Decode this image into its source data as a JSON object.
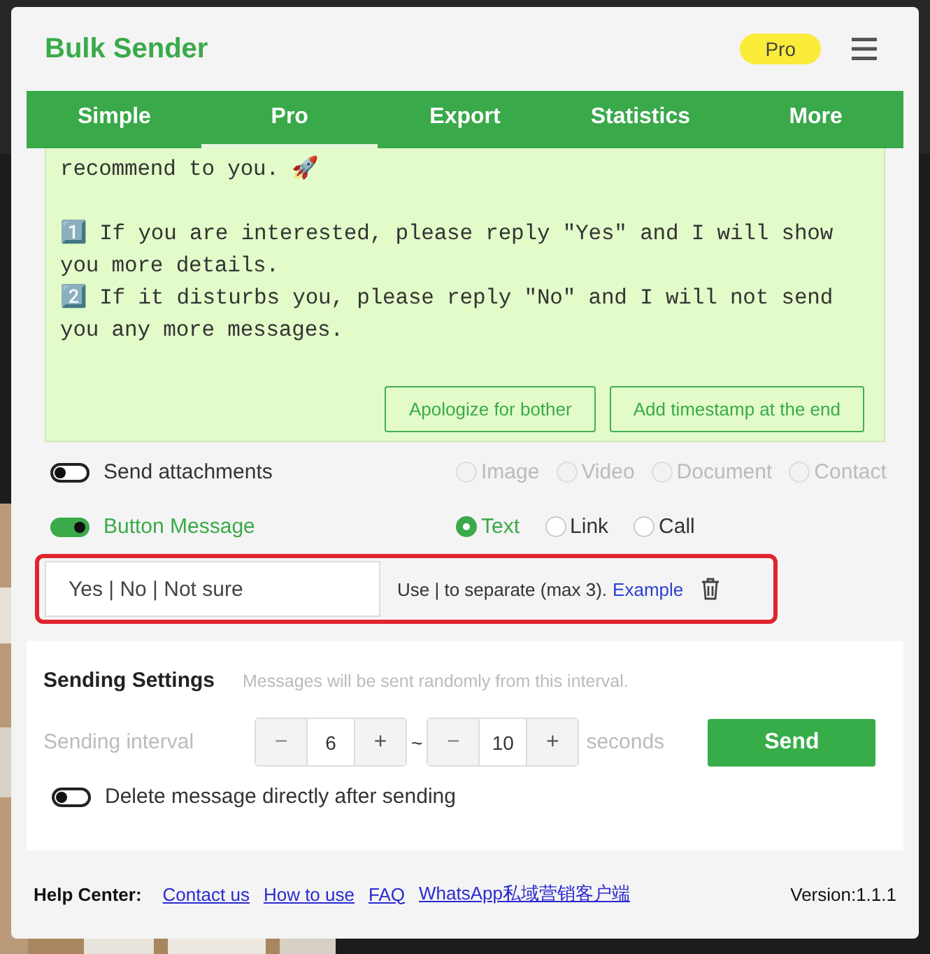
{
  "app": {
    "title": "Bulk Sender",
    "badge": "Pro"
  },
  "tabs": [
    {
      "label": "Simple",
      "selected": false
    },
    {
      "label": "Pro",
      "selected": true
    },
    {
      "label": "Export",
      "selected": false
    },
    {
      "label": "Statistics",
      "selected": false
    },
    {
      "label": "More",
      "selected": false
    }
  ],
  "message": {
    "text": "recommend to you. 🚀\n\n1️⃣ If you are interested, please reply \"Yes\" and I will show you more details.\n2️⃣ If it disturbs you, please reply \"No\" and I will not send you any more messages.",
    "buttons": [
      "Apologize for bother",
      "Add timestamp at the end"
    ]
  },
  "attachments": {
    "label": "Send attachments",
    "on": false,
    "types": [
      {
        "label": "Image",
        "selected": false,
        "disabled": true
      },
      {
        "label": "Video",
        "selected": false,
        "disabled": true
      },
      {
        "label": "Document",
        "selected": false,
        "disabled": true
      },
      {
        "label": "Contact",
        "selected": false,
        "disabled": true
      }
    ]
  },
  "button_message": {
    "label": "Button Message",
    "on": true,
    "types": [
      {
        "label": "Text",
        "selected": true
      },
      {
        "label": "Link",
        "selected": false
      },
      {
        "label": "Call",
        "selected": false
      }
    ],
    "value": "Yes | No | Not sure",
    "hint": "Use | to separate (max 3).",
    "link": "Example"
  },
  "sending_settings": {
    "title": "Sending Settings",
    "note": "Messages will be sent randomly from this interval.",
    "interval_label": "Sending interval",
    "steppers": [
      {
        "minus": "−",
        "value": "6",
        "plus": "+"
      },
      {
        "minus": "−",
        "value": "10",
        "plus": "+"
      }
    ],
    "separator": "~",
    "unit": "seconds",
    "send": "Send",
    "delete_label": "Delete message directly after sending",
    "delete_on": false
  },
  "footer": {
    "label": "Help Center:",
    "links": [
      "Contact us",
      "How to use",
      "FAQ",
      "WhatsApp私域营销客户端"
    ],
    "version": "Version:1.1.1"
  }
}
